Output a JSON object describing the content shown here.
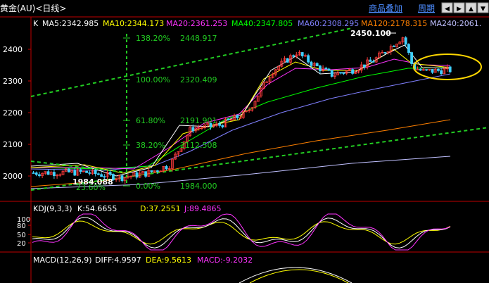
{
  "header": {
    "title": "黄金(AU)<日线>",
    "overlay_label": "商品叠加",
    "period_label": "周期",
    "nav_arrows": [
      "◀",
      "▶",
      "▲",
      "▼"
    ]
  },
  "colors": {
    "up": "#ff3b3b",
    "down": "#3fd0ff",
    "ma5": "#ffffff",
    "ma10": "#ffff00",
    "ma20": "#ff33ff",
    "ma40": "#00ff00",
    "ma60": "#8080ff",
    "ma120": "#ff8000",
    "ma240": "#c0c0ff",
    "fib": "#22cc22",
    "trend": "#22cc22",
    "axis": "#c00000",
    "menu_link": "#4c8cff"
  },
  "ma_legend": {
    "prefix": "K",
    "items": [
      {
        "key": "ma5",
        "label": "MA5:2342.985"
      },
      {
        "key": "ma10",
        "label": "MA10:2344.173"
      },
      {
        "key": "ma20",
        "label": "MA20:2361.253"
      },
      {
        "key": "ma40",
        "label": "MA40:2347.805"
      },
      {
        "key": "ma60",
        "label": "MA60:2308.295"
      },
      {
        "key": "ma120",
        "label": "MA120:2178.315"
      },
      {
        "key": "ma240",
        "label": "MA240:2061."
      }
    ]
  },
  "chart_data": [
    {
      "type": "candlestick",
      "y_ticks": [
        2000,
        2100,
        2200,
        2300,
        2400
      ],
      "ylim": [
        1950,
        2480
      ],
      "annotations": {
        "high_label": "2450.100",
        "low_label": "1984.088"
      },
      "fibonacci": [
        {
          "pct": "138.20%",
          "price": "2448.917",
          "value": 2448.917
        },
        {
          "pct": "100.00%",
          "price": "2320.409",
          "value": 2320.409
        },
        {
          "pct": "61.80%",
          "price": "2191.901",
          "value": 2191.901
        },
        {
          "pct": "38.20%",
          "price": "2112.508",
          "value": 2112.508
        },
        {
          "pct": "0.00%",
          "price": "1984.000",
          "value": 1984.0
        }
      ],
      "extra_label": "23.60%",
      "series_legend": "ma_legend"
    },
    {
      "type": "line",
      "legend": {
        "title": "KDJ(9,3,3)",
        "k": "K:54.6655",
        "d": "D:37.2551",
        "j": "J:89.4865"
      },
      "y_ticks": [
        20,
        50,
        80,
        100
      ],
      "ylim": [
        0,
        110
      ]
    },
    {
      "type": "line",
      "legend": {
        "title": "MACD(12,26,9)",
        "diff": "DIFF:4.9597",
        "dea": "DEA:9.5613",
        "macd": "MACD:-9.2032"
      }
    }
  ]
}
